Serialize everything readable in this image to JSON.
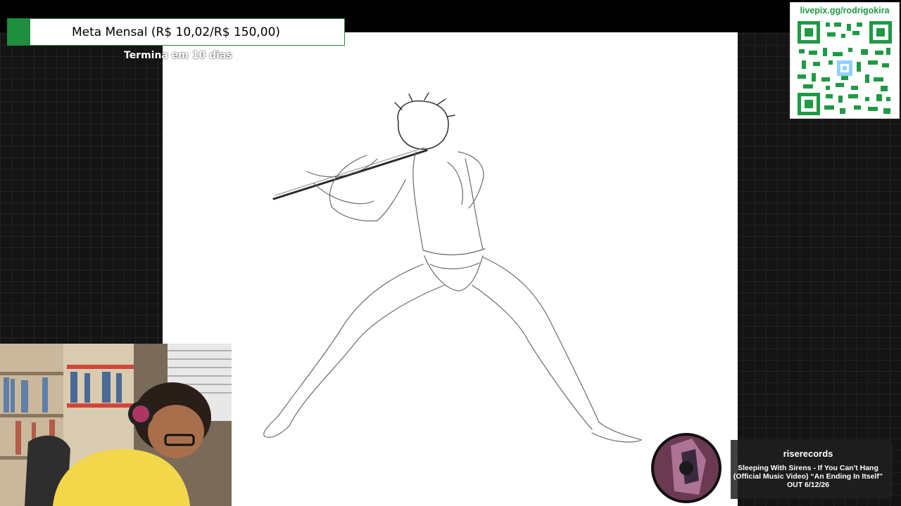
{
  "goal": {
    "label": "Meta Mensal (R$ 10,02/R$ 150,00)",
    "subtitle": "Termina em 10 dias",
    "current": 10.02,
    "target": 150.0,
    "progress_fraction": 0.067,
    "fill_color": "#1f8f3f"
  },
  "donation": {
    "url": "livepix.gg/rodrigokira",
    "accent_color": "#1f9a44"
  },
  "now_playing": {
    "channel": "riserecords",
    "title": "Sleeping With Sirens - If You Can't Hang (Official Music Video) “An Ending In Itself” OUT 6/12/26"
  },
  "icons": {
    "qr": "qr-code-icon",
    "album": "album-art-icon"
  }
}
